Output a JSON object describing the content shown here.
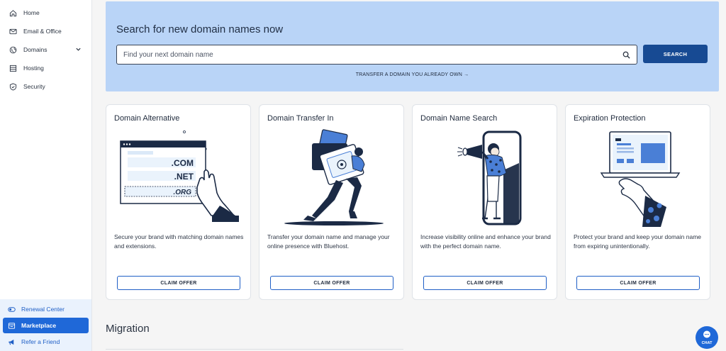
{
  "sidebar": {
    "items": [
      {
        "label": "Home",
        "icon": "home-icon"
      },
      {
        "label": "Email & Office",
        "icon": "mail-icon"
      },
      {
        "label": "Domains",
        "icon": "globe-icon",
        "expandable": true
      },
      {
        "label": "Hosting",
        "icon": "server-icon"
      },
      {
        "label": "Security",
        "icon": "shield-icon"
      }
    ],
    "bottom_items": [
      {
        "label": "Renewal Center",
        "icon": "toggle-icon"
      },
      {
        "label": "Marketplace",
        "icon": "store-icon",
        "active": true
      },
      {
        "label": "Refer a Friend",
        "icon": "megaphone-icon"
      }
    ]
  },
  "search": {
    "heading": "Search for new domain names now",
    "placeholder": "Find your next domain name",
    "button_label": "SEARCH",
    "transfer_link": "TRANSFER A DOMAIN YOU ALREADY OWN"
  },
  "cards": [
    {
      "title": "Domain Alternative",
      "description": "Secure your brand with matching domain names and extensions.",
      "button": "CLAIM OFFER",
      "illustration": {
        "com": ".COM",
        "net": ".NET",
        "org": ".ORG"
      }
    },
    {
      "title": "Domain Transfer In",
      "description": "Transfer your domain name and manage your online presence with Bluehost.",
      "button": "CLAIM OFFER"
    },
    {
      "title": "Domain Name Search",
      "description": "Increase visibility online and enhance your brand with the perfect domain name.",
      "button": "CLAIM OFFER"
    },
    {
      "title": "Expiration Protection",
      "description": "Protect your brand and keep your domain name from expiring unintentionally.",
      "button": "CLAIM OFFER"
    }
  ],
  "migration": {
    "heading": "Migration"
  },
  "chat": {
    "label": "CHAT"
  },
  "colors": {
    "accent": "#1f68d8",
    "search_button": "#174a93",
    "banner": "#b9d4f7",
    "illustration_dark": "#1b2a45",
    "illustration_blue": "#4a7fd6"
  }
}
